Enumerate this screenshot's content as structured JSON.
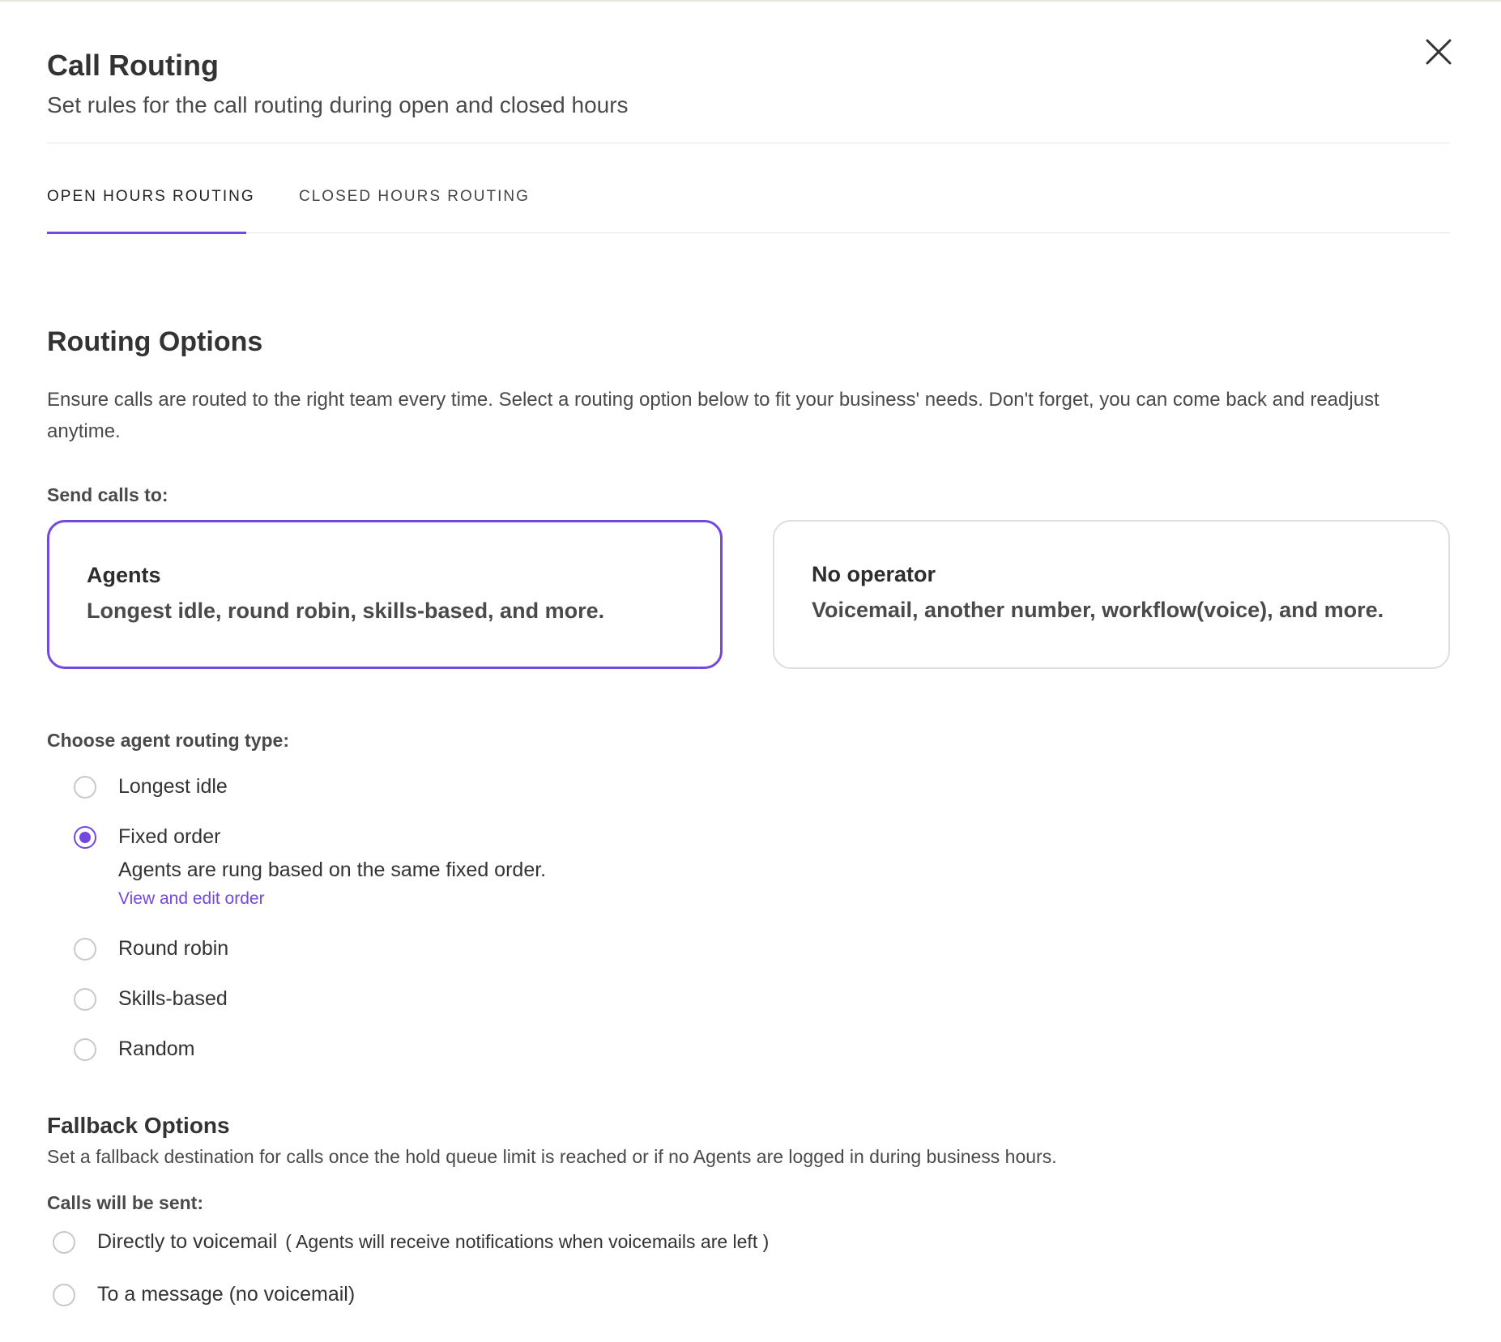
{
  "header": {
    "title": "Call Routing",
    "subtitle": "Set rules for the call routing during open and closed hours",
    "close_icon": "close-icon"
  },
  "tabs": [
    {
      "label": "OPEN HOURS ROUTING",
      "active": true
    },
    {
      "label": "CLOSED HOURS ROUTING",
      "active": false
    }
  ],
  "routing": {
    "title": "Routing Options",
    "description": "Ensure calls are routed to the right team every time. Select a routing option below to fit your business' needs. Don't forget, you can come back and readjust anytime.",
    "send_label": "Send calls to:",
    "cards": [
      {
        "title": "Agents",
        "description": "Longest idle, round robin, skills-based, and more.",
        "selected": true
      },
      {
        "title": "No operator",
        "description": "Voicemail, another number, workflow(voice), and more.",
        "selected": false
      }
    ]
  },
  "agent_routing": {
    "label": "Choose agent routing type:",
    "options": [
      {
        "label": "Longest idle",
        "checked": false
      },
      {
        "label": "Fixed order",
        "checked": true
      },
      {
        "label": "Round robin",
        "checked": false
      },
      {
        "label": "Skills-based",
        "checked": false
      },
      {
        "label": "Random",
        "checked": false
      }
    ],
    "fixed_order_helper": "Agents are rung based on the same fixed order.",
    "fixed_order_link": "View and edit order"
  },
  "fallback": {
    "title": "Fallback Options",
    "description": "Set a fallback destination for calls once the hold queue limit is reached or if no Agents are logged in during business hours.",
    "sent_label": "Calls will be sent:",
    "options": [
      {
        "label": "Directly to voicemail",
        "note": "( Agents will receive notifications when voicemails are left )",
        "checked": false
      },
      {
        "label": "To a message (no voicemail)",
        "note": "",
        "checked": false
      }
    ]
  },
  "colors": {
    "accent": "#7347e0",
    "border": "#dedede",
    "text": "#333333"
  }
}
